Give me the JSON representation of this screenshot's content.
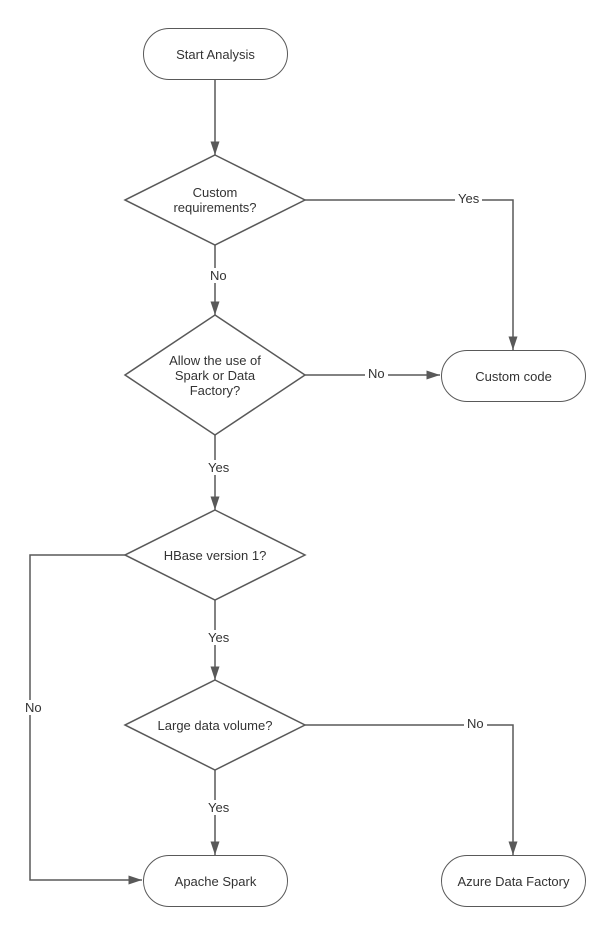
{
  "nodes": {
    "start": "Start Analysis",
    "custom_req": "Custom requirements?",
    "spark_or_df": "Allow the use of Spark or Data Factory?",
    "custom_code": "Custom code",
    "hbase_v1": "HBase version 1?",
    "large_volume": "Large data volume?",
    "apache_spark": "Apache Spark",
    "azure_df": "Azure Data Factory"
  },
  "edges": {
    "yes": "Yes",
    "no": "No"
  }
}
